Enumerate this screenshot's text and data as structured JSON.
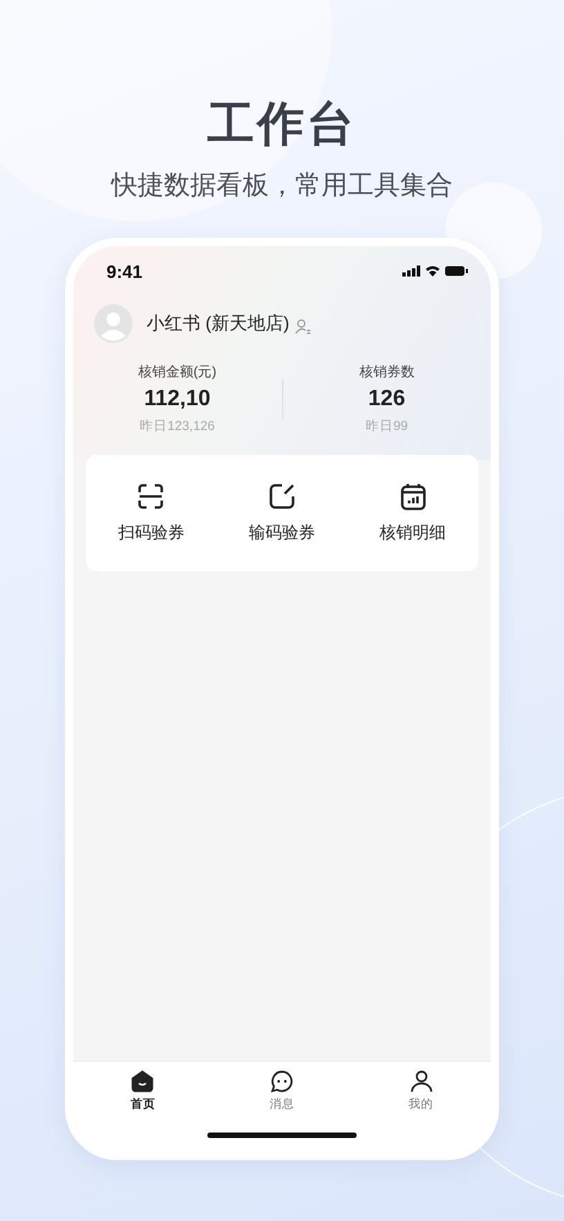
{
  "headline": {
    "title": "工作台",
    "subtitle": "快捷数据看板，常用工具集合"
  },
  "status_bar": {
    "time": "9:41"
  },
  "store": {
    "name": "小红书 (新天地店)"
  },
  "stats": [
    {
      "label": "核销金额(元)",
      "value": "112,10",
      "previous": "昨日123,126"
    },
    {
      "label": "核销券数",
      "value": "126",
      "previous": "昨日99"
    }
  ],
  "tools": [
    {
      "kind": "scan",
      "label": "扫码验券"
    },
    {
      "kind": "edit",
      "label": "输码验券"
    },
    {
      "kind": "report",
      "label": "核销明细"
    }
  ],
  "tab_bar": [
    {
      "kind": "home",
      "label": "首页",
      "selected": true
    },
    {
      "kind": "message",
      "label": "消息",
      "selected": false
    },
    {
      "kind": "profile",
      "label": "我的",
      "selected": false
    }
  ]
}
